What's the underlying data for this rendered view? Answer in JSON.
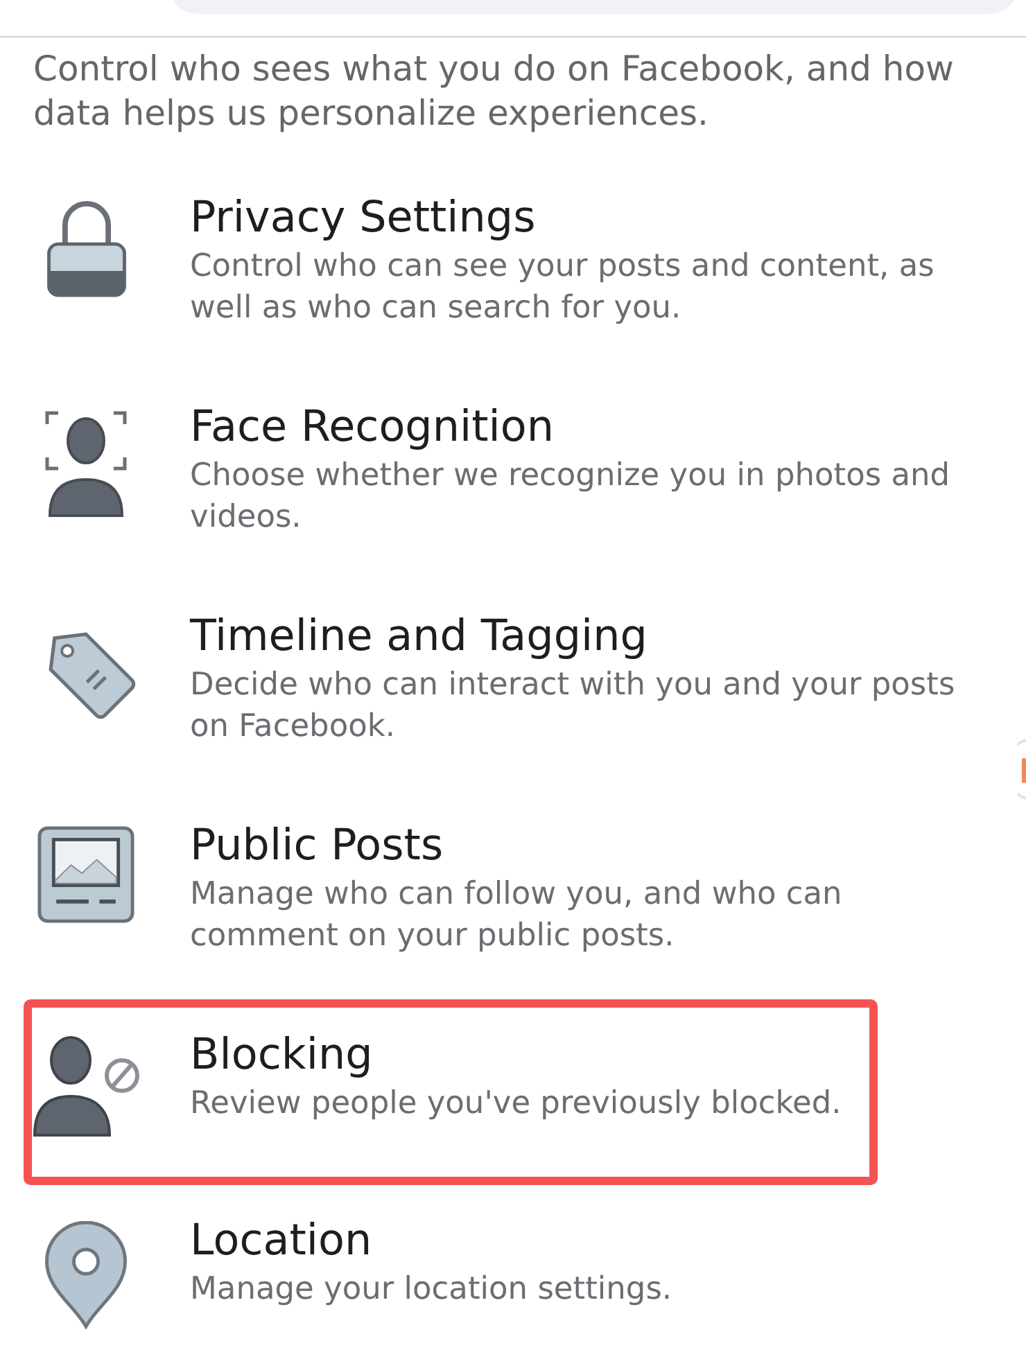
{
  "intro": "Control who sees what you do on Facebook, and how data helps us personalize experiences.",
  "items": [
    {
      "title": "Privacy Settings",
      "description": "Control who can see your posts and content, as well as who can search for you.",
      "highlighted": false
    },
    {
      "title": "Face Recognition",
      "description": "Choose whether we recognize you in photos and videos.",
      "highlighted": false
    },
    {
      "title": "Timeline and Tagging",
      "description": "Decide who can interact with you and your posts on Facebook.",
      "highlighted": false
    },
    {
      "title": "Public Posts",
      "description": "Manage who can follow you, and who can comment on your public posts.",
      "highlighted": false
    },
    {
      "title": "Blocking",
      "description": "Review people you've previously blocked.",
      "highlighted": true
    },
    {
      "title": "Location",
      "description": "Manage your location settings.",
      "highlighted": false
    }
  ]
}
